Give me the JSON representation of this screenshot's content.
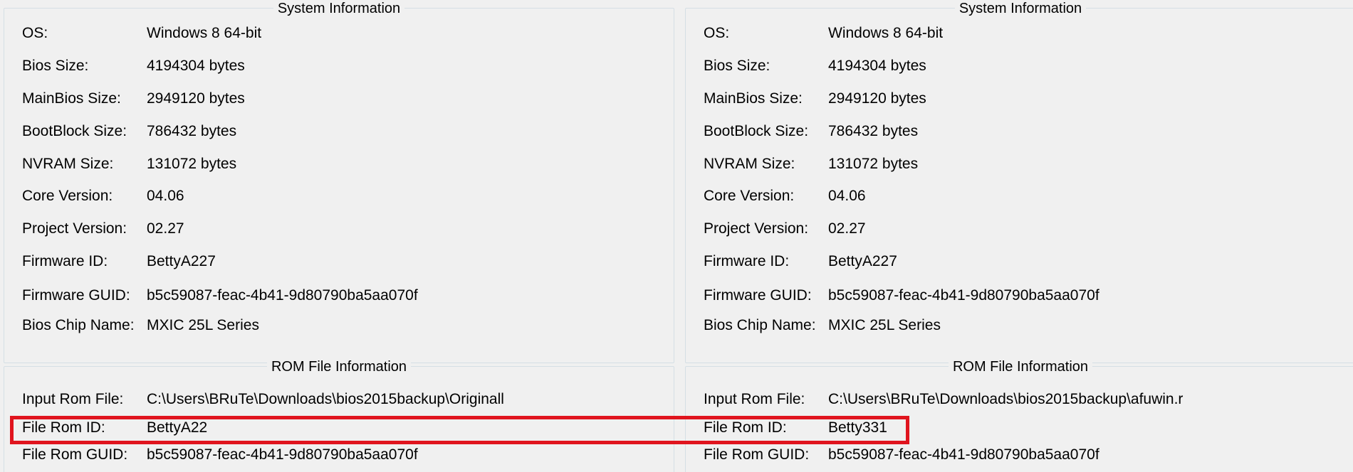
{
  "left": {
    "system_info": {
      "title": "System Information",
      "rows": [
        {
          "label": "OS:",
          "value": "Windows 8 64-bit"
        },
        {
          "label": "Bios Size:",
          "value": "4194304 bytes"
        },
        {
          "label": "MainBios Size:",
          "value": "2949120 bytes"
        },
        {
          "label": "BootBlock Size:",
          "value": "786432 bytes"
        },
        {
          "label": "NVRAM Size:",
          "value": "131072 bytes"
        },
        {
          "label": "Core Version:",
          "value": "04.06"
        },
        {
          "label": "Project Version:",
          "value": "02.27"
        },
        {
          "label": "Firmware ID:",
          "value": "BettyA227"
        },
        {
          "label": "Firmware GUID:",
          "value": "b5c59087-feac-4b41-9d80790ba5aa070f"
        },
        {
          "label": "Bios Chip Name:",
          "value": "MXIC 25L Series"
        }
      ]
    },
    "rom_info": {
      "title": "ROM File Information",
      "rows": [
        {
          "label": "Input Rom File:",
          "value": "C:\\Users\\BRuTe\\Downloads\\bios2015backup\\Originall"
        },
        {
          "label": "File Rom ID:",
          "value": "BettyA22"
        },
        {
          "label": "File Rom GUID:",
          "value": "b5c59087-feac-4b41-9d80790ba5aa070f"
        }
      ]
    }
  },
  "right": {
    "system_info": {
      "title": "System Information",
      "rows": [
        {
          "label": "OS:",
          "value": "Windows 8 64-bit"
        },
        {
          "label": "Bios Size:",
          "value": "4194304 bytes"
        },
        {
          "label": "MainBios Size:",
          "value": "2949120 bytes"
        },
        {
          "label": "BootBlock Size:",
          "value": "786432 bytes"
        },
        {
          "label": "NVRAM Size:",
          "value": "131072 bytes"
        },
        {
          "label": "Core Version:",
          "value": "04.06"
        },
        {
          "label": "Project Version:",
          "value": "02.27"
        },
        {
          "label": "Firmware ID:",
          "value": "BettyA227"
        },
        {
          "label": "Firmware GUID:",
          "value": "b5c59087-feac-4b41-9d80790ba5aa070f"
        },
        {
          "label": "Bios Chip Name:",
          "value": "MXIC 25L Series"
        }
      ]
    },
    "rom_info": {
      "title": "ROM File Information",
      "rows": [
        {
          "label": "Input Rom File:",
          "value": "C:\\Users\\BRuTe\\Downloads\\bios2015backup\\afuwin.r"
        },
        {
          "label": "File Rom ID:",
          "value": "Betty331"
        },
        {
          "label": "File Rom GUID:",
          "value": "b5c59087-feac-4b41-9d80790ba5aa070f"
        }
      ]
    }
  },
  "colors": {
    "highlight": "#e0141e",
    "group_border": "#d5dfe5",
    "background": "#f0f0f0"
  }
}
